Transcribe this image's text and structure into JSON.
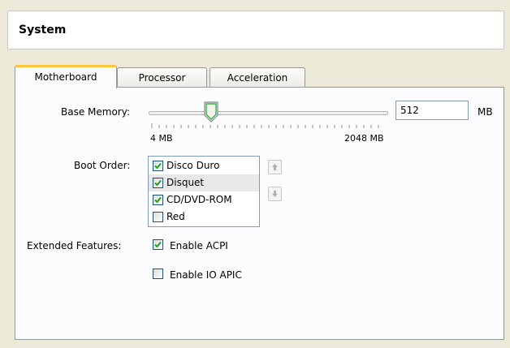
{
  "header": {
    "title": "System"
  },
  "tabs": [
    {
      "label": "Motherboard",
      "active": true
    },
    {
      "label": "Processor",
      "active": false
    },
    {
      "label": "Acceleration",
      "active": false
    }
  ],
  "memory": {
    "label": "Base Memory:",
    "min_label": "4 MB",
    "max_label": "2048 MB",
    "value": "512",
    "unit": "MB"
  },
  "boot": {
    "label": "Boot Order:",
    "items": [
      {
        "label": "Disco Duro",
        "checked": true
      },
      {
        "label": "Disquet",
        "checked": true
      },
      {
        "label": "CD/DVD-ROM",
        "checked": true
      },
      {
        "label": "Red",
        "checked": false
      }
    ],
    "up_icon": "arrow-up-icon",
    "down_icon": "arrow-down-icon"
  },
  "extended": {
    "label": "Extended Features:",
    "acpi": {
      "label": "Enable ACPI",
      "checked": true
    },
    "ioapic": {
      "label": "Enable IO APIC",
      "checked": false
    }
  },
  "colors": {
    "tab_accent": "#ffc83c",
    "check": "#21a121"
  }
}
